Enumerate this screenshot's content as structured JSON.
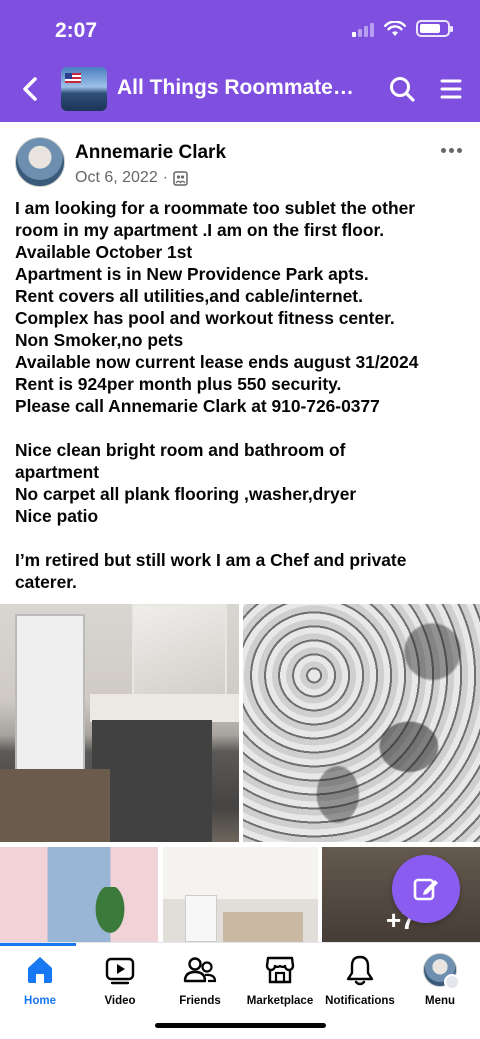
{
  "status_bar": {
    "time": "2:07"
  },
  "header": {
    "title": "All Things Roommate…",
    "back_icon": "chevron-left-icon",
    "search_icon": "search-icon",
    "menu_icon": "hamburger-icon",
    "background": "#7f4fe0"
  },
  "post": {
    "author": "Annemarie Clark",
    "date": "Oct 6, 2022",
    "separator": "·",
    "audience_icon": "group-audience-icon",
    "lines": [
      "I am looking for a roommate too sublet the other",
      "room in my apartment .I am on the first floor.",
      "Available October 1st",
      "Apartment is in New Providence Park apts.",
      "Rent covers all utilities,and cable/internet.",
      "Complex has pool and workout fitness center.",
      "Non Smoker,no pets",
      "Available now current lease ends august 31/2024",
      "Rent is 924per month plus 550 security.",
      "Please call Annemarie Clark at 910-726-0377",
      "",
      "Nice clean bright room and bathroom  of",
      "apartment",
      "No carpet all  plank  flooring ,washer,dryer",
      "Nice patio",
      "",
      "I’m retired but still work I am a Chef and private",
      "caterer."
    ],
    "more_photos": "+7"
  },
  "tabs": [
    {
      "label": "Home",
      "icon": "home-icon"
    },
    {
      "label": "Video",
      "icon": "video-icon"
    },
    {
      "label": "Friends",
      "icon": "friends-icon"
    },
    {
      "label": "Marketplace",
      "icon": "marketplace-icon"
    },
    {
      "label": "Notifications",
      "icon": "bell-icon"
    },
    {
      "label": "Menu",
      "icon": "profile-menu-icon"
    }
  ],
  "colors": {
    "accent": "#1877f2",
    "header": "#7f4fe0",
    "fab": "#8b5cf0"
  }
}
